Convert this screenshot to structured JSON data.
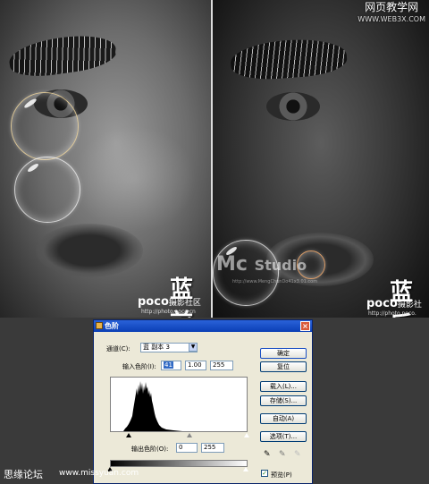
{
  "watermark": {
    "top_title": "网页教学网",
    "top_url": "WWW.WEB3X.COM"
  },
  "left_photo": {
    "signature": "蓝前",
    "brand": "poco",
    "brand_sub": "摄影社区",
    "url": "http://photo.poco.cn"
  },
  "right_photo": {
    "signature": "蓝后",
    "brand": "poco",
    "brand_sub": "摄影社",
    "url": "http://photo.poco.",
    "studio_logo": "Mc",
    "studio_name": "Studio",
    "studio_url": "http://www.MengChunDo41x3.01.com"
  },
  "dialog": {
    "title": "色阶",
    "channel_label": "通道(C):",
    "channel_value": "蓝 副本 3",
    "input_levels_label": "输入色阶(I):",
    "input_black": "41",
    "input_gamma": "1.00",
    "input_white": "255",
    "output_levels_label": "输出色阶(O):",
    "output_black": "0",
    "output_white": "255",
    "buttons": {
      "ok": "确定",
      "reset": "复位",
      "load": "载入(L)...",
      "save": "存储(S)...",
      "auto": "自动(A)",
      "options": "选项(T)..."
    },
    "preview_label": "预览(P)",
    "preview_checked": true
  },
  "footer": {
    "left_text": "思缘论坛",
    "right_text": "www.missyuan.com"
  }
}
